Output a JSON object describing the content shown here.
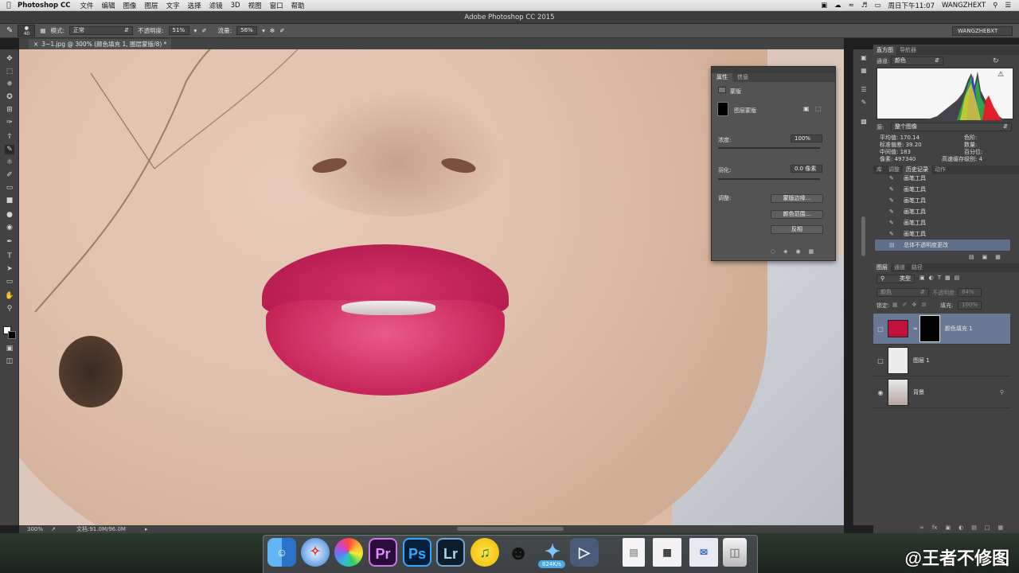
{
  "menubar": {
    "app_name": "Photoshop CC",
    "items": [
      "文件",
      "编辑",
      "图像",
      "图层",
      "文字",
      "选择",
      "滤镜",
      "3D",
      "视图",
      "窗口",
      "帮助"
    ],
    "clock": "周日下午11:07",
    "user": "WANGZHEXT"
  },
  "window": {
    "title": "Adobe Photoshop CC 2015"
  },
  "options": {
    "brush_size": "40",
    "mode_label": "模式:",
    "mode_value": "正常",
    "opacity_label": "不透明度:",
    "opacity_value": "51%",
    "flow_label": "流量:",
    "flow_value": "56%",
    "workspace": "WANGZHEBXT"
  },
  "document": {
    "tab": "3~1.jpg @ 300% (颜色填充 1, 图层蒙版/8) *"
  },
  "properties": {
    "tabs": [
      "属性",
      "信息"
    ],
    "section": "蒙版",
    "mask_label": "图层蒙版",
    "density_label": "浓度:",
    "density_value": "100%",
    "feather_label": "羽化:",
    "feather_value": "0.0 像素",
    "adjust_label": "调整:",
    "buttons": [
      "蒙版边缘...",
      "颜色范围...",
      "反相"
    ]
  },
  "histogram": {
    "tabs": [
      "直方图",
      "导航器"
    ],
    "channel_label": "通道:",
    "channel_value": "颜色",
    "source_label": "源:",
    "source_value": "整个图像",
    "stats_left": [
      {
        "label": "平均值:",
        "value": "170.14"
      },
      {
        "label": "标准偏差:",
        "value": "39.20"
      },
      {
        "label": "中间值:",
        "value": "183"
      },
      {
        "label": "像素:",
        "value": "497340"
      }
    ],
    "stats_right": [
      {
        "label": "色阶:",
        "value": ""
      },
      {
        "label": "数量:",
        "value": ""
      },
      {
        "label": "百分位:",
        "value": ""
      },
      {
        "label": "高速缓存级别:",
        "value": "4"
      }
    ]
  },
  "history": {
    "tabs": [
      "库",
      "调整",
      "历史记录",
      "动作"
    ],
    "items": [
      "画笔工具",
      "画笔工具",
      "画笔工具",
      "画笔工具",
      "画笔工具",
      "画笔工具",
      "总体不透明度更改"
    ]
  },
  "layers": {
    "tabs": [
      "图层",
      "通道",
      "路径"
    ],
    "filter_label": "类型",
    "blend_mode": "颜色",
    "opacity_label": "不透明度:",
    "opacity_value": "84%",
    "lock_label": "锁定:",
    "fill_label": "填充:",
    "fill_value": "100%",
    "items": [
      {
        "name": "颜色填充 1",
        "active": true
      },
      {
        "name": "图层 1",
        "active": false
      },
      {
        "name": "背景",
        "active": false
      }
    ]
  },
  "status": {
    "zoom": "300%",
    "doc_size": "文档:91.0M/96.0M"
  },
  "dock": {
    "apps": [
      "finder",
      "safari",
      "photos",
      "Pr",
      "Ps",
      "Lr",
      "music",
      "qq",
      "bird",
      "video",
      "file",
      "calendar",
      "preview",
      "trash"
    ],
    "net_speed": "824K/s"
  },
  "watermark": "@王者不修图",
  "colors": {
    "panel": "#535353",
    "dark": "#424242",
    "accent": "#6a7993",
    "lip": "#c62559"
  }
}
